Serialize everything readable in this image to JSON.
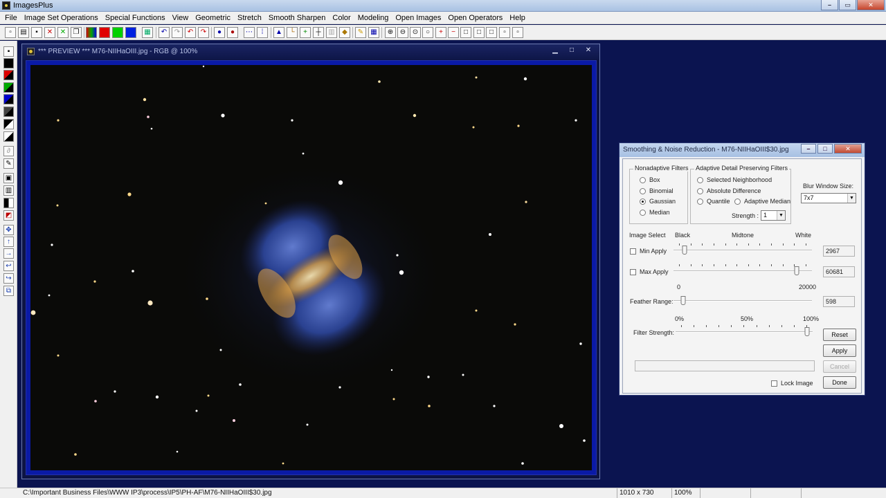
{
  "app": {
    "title": "ImagesPlus"
  },
  "menu": [
    "File",
    "Image Set Operations",
    "Special Functions",
    "View",
    "Geometric",
    "Stretch",
    "Smooth Sharpen",
    "Color",
    "Modeling",
    "Open Images",
    "Open Operators",
    "Help"
  ],
  "toolbar_icons": [
    "new-file",
    "open-folder",
    "save",
    "close-image",
    "close-all",
    "copy",
    "rgb-channels",
    "red-channel",
    "green-channel",
    "blue-channel",
    "grid",
    "undo",
    "redo",
    "undo-all",
    "redo-all",
    "circle-select",
    "circle-select-2",
    "dots-select",
    "dots-select-2",
    "histogram",
    "levels",
    "crosshair-plus",
    "crosshair",
    "crop",
    "palette",
    "pencil",
    "grid-view",
    "zoom-in",
    "zoom-out",
    "zoom-fit",
    "zoom-100",
    "zoom-in-box",
    "zoom-out-box",
    "window-1",
    "window-2",
    "window-3",
    "window-4",
    "window-5"
  ],
  "left_tools": [
    "save",
    "black-square",
    "red-black",
    "green-black",
    "blue-black",
    "mix",
    "black-white",
    "contrast",
    "pencil",
    "frame",
    "bars",
    "black-bar",
    "select-box",
    "move",
    "arrow-up",
    "arrow-right",
    "arrow-back",
    "arrow-turn",
    "stack"
  ],
  "preview_window": {
    "title": "*** PREVIEW *** M76-NIIHaOIII.jpg - RGB @ 100%"
  },
  "dialog": {
    "title": "Smoothing & Noise Reduction - M76-NIIHaOIII$30.jpg",
    "nonadaptive": {
      "label": "Nonadaptive Filters",
      "options": [
        "Box",
        "Binomial",
        "Gaussian",
        "Median"
      ],
      "selected": "Gaussian"
    },
    "adaptive": {
      "label": "Adaptive Detail Preserving Filters",
      "options": {
        "selected_neighborhood": "Selected Neighborhood",
        "absolute_difference": "Absolute Difference",
        "quantile": "Quantile",
        "adaptive_median": "Adaptive Median"
      },
      "strength_label": "Strength :",
      "strength_value": "1"
    },
    "blur": {
      "label": "Blur Window Size:",
      "value": "7x7"
    },
    "image_select": {
      "label": "Image Select",
      "black": "Black",
      "midtone": "Midtone",
      "white": "White",
      "min_apply": "Min Apply",
      "min_value": "2967",
      "min_fraction": 0.045,
      "max_apply": "Max Apply",
      "max_value": "60681",
      "max_fraction": 0.926,
      "range_min": "0",
      "range_max": "20000"
    },
    "feather": {
      "label": "Feather Range:",
      "value": "598",
      "fraction": 0.03
    },
    "filter_strength": {
      "label": "Filter Strength:",
      "pct0": "0%",
      "pct50": "50%",
      "pct100": "100%",
      "fraction": 1.0
    },
    "buttons": {
      "reset": "Reset",
      "apply": "Apply",
      "cancel": "Cancel",
      "done": "Done"
    },
    "lock_image": "Lock Image"
  },
  "statusbar": {
    "path": "C:\\Important Business Files\\WWW IP3\\process\\IP5\\PH-AF\\M76-NIIHaOIII$30.jpg",
    "dimensions": "1010 x 730",
    "zoom": "100%"
  },
  "colors": {
    "mdi_background": "#0b1450",
    "image_border": "#0a1aa6",
    "nebula_blue": "#3a5fcf",
    "nebula_orange": "#e0a040"
  }
}
